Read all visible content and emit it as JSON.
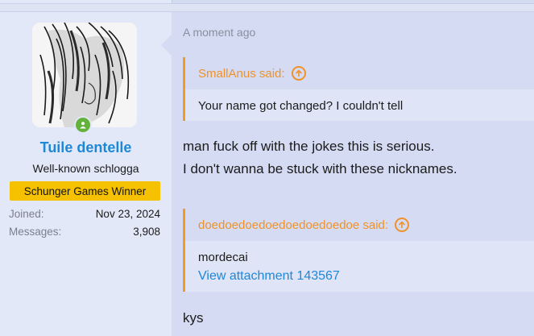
{
  "user": {
    "name": "Tuile dentelle",
    "title": "Well-known schlogga",
    "banner": "Schunger Games Winner",
    "stats": [
      {
        "key": "Joined:",
        "value": "Nov 23, 2024"
      },
      {
        "key": "Messages:",
        "value": "3,908"
      }
    ],
    "online": true
  },
  "post": {
    "time": "A moment ago",
    "quotes": [
      {
        "author_said": "SmallAnus said:",
        "text": "Your name got changed? I couldn't tell"
      },
      {
        "author_said": "doedoedoedoedoedoedoedoe said:",
        "text": "mordecai",
        "attachment_link": "View attachment 143567"
      }
    ],
    "reply1_line1": "man fuck off with the jokes this is serious.",
    "reply1_line2": "I don't wanna be stuck with these nicknames.",
    "reply2": "kys"
  },
  "colors": {
    "username": "#1e88d8",
    "banner_bg": "#f6c200",
    "quote_accent": "#f0922a",
    "online": "#63b23c",
    "link": "#1e88d8"
  },
  "icons": {
    "online": "online-status-icon",
    "quote_jump": "arrow-up-circle-icon"
  }
}
